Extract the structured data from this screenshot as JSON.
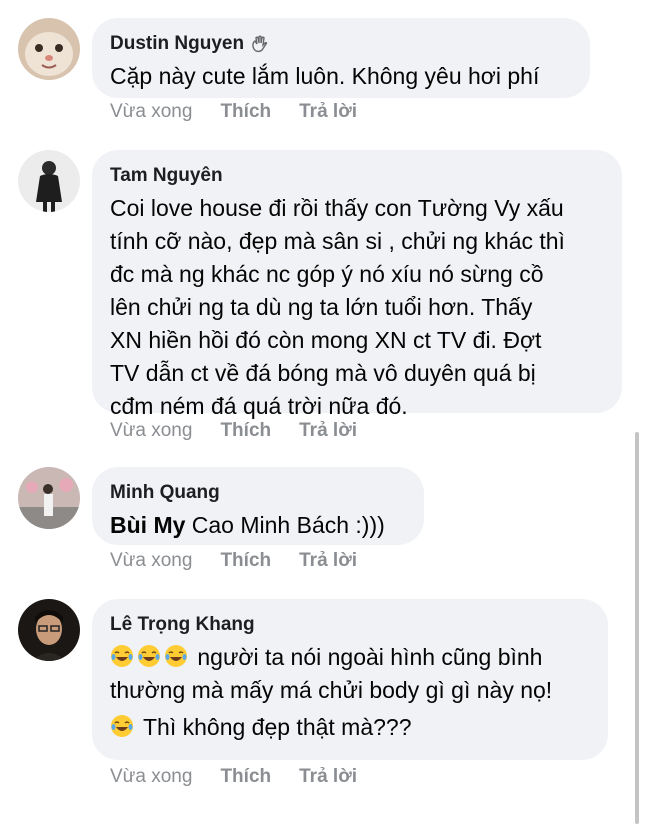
{
  "comments": [
    {
      "name": "Dustin Nguyen",
      "text": "Cặp này cute lắm luôn. Không yêu hơi phí",
      "time": "Vừa xong",
      "like": "Thích",
      "reply": "Trả lời"
    },
    {
      "name": "Tam Nguyên",
      "text_lines": [
        "Coi love house đi rồi thấy con Tường Vy xấu",
        "tính cỡ nào, đẹp mà sân si , chửi ng khác thì",
        "đc mà ng khác nc góp ý nó xíu nó sừng cồ",
        "lên chửi ng ta dù ng ta lớn tuổi hơn. Thấy",
        "XN hiền hồi đó còn mong XN ct TV đi. Đợt",
        "TV dẫn ct về đá bóng mà vô duyên quá bị",
        "cđm ném đá quá trời nữa đó."
      ],
      "time": "Vừa xong",
      "like": "Thích",
      "reply": "Trả lời"
    },
    {
      "name": "Minh Quang",
      "mention": "Bùi My",
      "text": "Cao Minh Bách :)))",
      "time": "Vừa xong",
      "like": "Thích",
      "reply": "Trả lời"
    },
    {
      "name": "Lê Trọng Khang",
      "line1": "người ta nói ngoài hình cũng bình",
      "line2": "thường mà mấy má chửi body gì gì này nọ!",
      "line3": "Thì không đẹp thật mà???",
      "time": "Vừa xong",
      "like": "Thích",
      "reply": "Trả lời"
    }
  ],
  "icons": {
    "badge": "waving-hand-icon",
    "emoji": "face-with-tears-of-joy-icon"
  },
  "colors": {
    "bubble": "#f0f2f5",
    "meta": "#8a8d91"
  }
}
